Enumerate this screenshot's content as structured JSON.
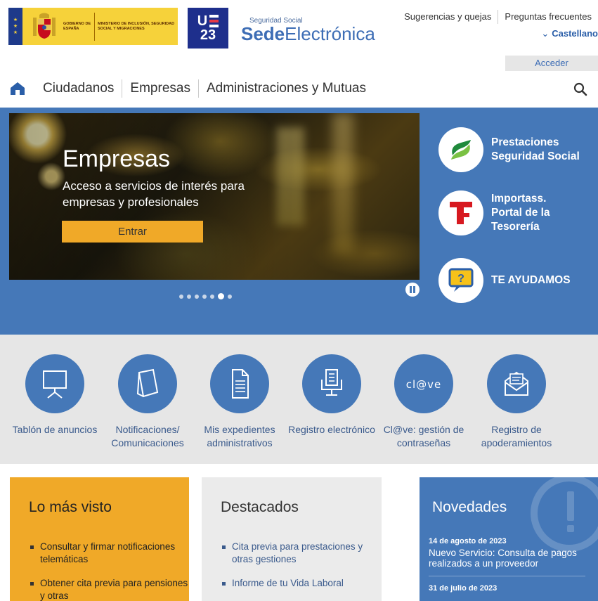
{
  "header": {
    "gov_text_1": "GOBIERNO DE ESPAÑA",
    "gov_text_2": "MINISTERIO DE INCLUSIÓN, SEGURIDAD SOCIAL Y MIGRACIONES",
    "ue_row1": "U",
    "ue_row2": "23",
    "sede_small": "Seguridad Social",
    "sede_bold": "Sede",
    "sede_light": "Electrónica",
    "links": [
      "Sugerencias y quejas",
      "Preguntas frecuentes"
    ],
    "language": "Castellano",
    "login": "Acceder"
  },
  "nav": {
    "items": [
      "Ciudadanos",
      "Empresas",
      "Administraciones y Mutuas"
    ]
  },
  "hero": {
    "title": "Empresas",
    "subtitle": "Acceso a servicios de interés para empresas y profesionales",
    "button": "Entrar",
    "slide_count": 7,
    "active_slide": 6
  },
  "quick_links": [
    {
      "label": "Prestaciones Seguridad Social",
      "icon": "prestaciones-logo-icon"
    },
    {
      "label": "Importass. Portal de la Tesorería",
      "icon": "importass-logo-icon"
    },
    {
      "label": "TE AYUDAMOS",
      "icon": "help-chat-icon"
    }
  ],
  "services": [
    {
      "label": "Tablón de anuncios",
      "icon": "noticeboard-icon"
    },
    {
      "label": "Notificaciones/ Comunicaciones",
      "icon": "notification-document-icon"
    },
    {
      "label": "Mis expedientes administrativos",
      "icon": "file-document-icon"
    },
    {
      "label": "Registro electrónico",
      "icon": "electronic-register-icon"
    },
    {
      "label": "Cl@ve: gestión de contraseñas",
      "icon": "clave-icon",
      "icon_text": "cl@ve"
    },
    {
      "label": "Registro de apoderamientos",
      "icon": "envelope-icon"
    }
  ],
  "lo_mas_visto": {
    "title": "Lo más visto",
    "items": [
      "Consultar y firmar notificaciones telemáticas",
      "Obtener cita previa para pensiones y otras"
    ]
  },
  "destacados": {
    "title": "Destacados",
    "items": [
      "Cita previa para prestaciones y otras gestiones",
      "Informe de tu Vida Laboral"
    ]
  },
  "novedades": {
    "title": "Novedades",
    "items": [
      {
        "date": "14 de agosto de 2023",
        "text": "Nuevo Servicio: Consulta de pagos realizados a un proveedor"
      },
      {
        "date": "31 de julio de 2023",
        "text": ""
      }
    ]
  },
  "colors": {
    "brand_blue": "#4578b8",
    "accent_yellow": "#f0a928",
    "light_gray": "#e6e6e6"
  }
}
